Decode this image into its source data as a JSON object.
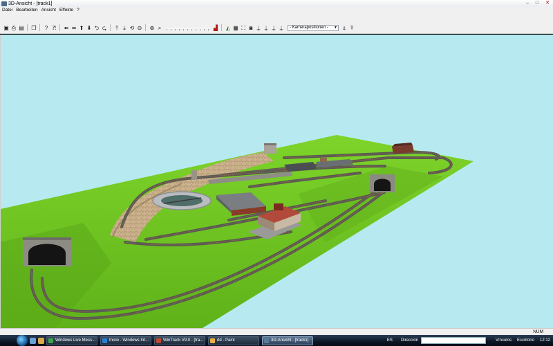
{
  "window": {
    "title": "3D-Ansicht - [track1]",
    "minimize_glyph": "–",
    "maximize_glyph": "□",
    "close_glyph": "✕"
  },
  "menu": {
    "items": [
      "Datei",
      "Bearbeiten",
      "Ansicht",
      "Effekte",
      "?"
    ]
  },
  "toolbar": {
    "camera_dropdown": "- Kamerapositionen -",
    "dropdown_arrow": "▼"
  },
  "statusbar": {
    "num": "NUM"
  },
  "taskbar": {
    "buttons": [
      {
        "label": "Windows Live Mess...",
        "icon_color": "#3ba34a"
      },
      {
        "label": "Inicio - Windows Int...",
        "icon_color": "#2a7fd4"
      },
      {
        "label": "WinTrack V9.0 - [tra...",
        "icon_color": "#c24a2a"
      },
      {
        "label": "dd - Paint",
        "icon_color": "#e8b040"
      },
      {
        "label": "3D-Ansicht - [track1]",
        "icon_color": "#5a7a9a"
      }
    ],
    "lang": "ES",
    "address_label": "Dirección",
    "vinculos": "Vínculos",
    "escritorio": "Escritorio",
    "clock": "12:12"
  },
  "colors": {
    "sky": "#b6eaf0",
    "grass": "#6fc41f",
    "grass_dark": "#4e9a14",
    "rail_bed": "#6d6b66",
    "rock": "#c8b08a"
  }
}
